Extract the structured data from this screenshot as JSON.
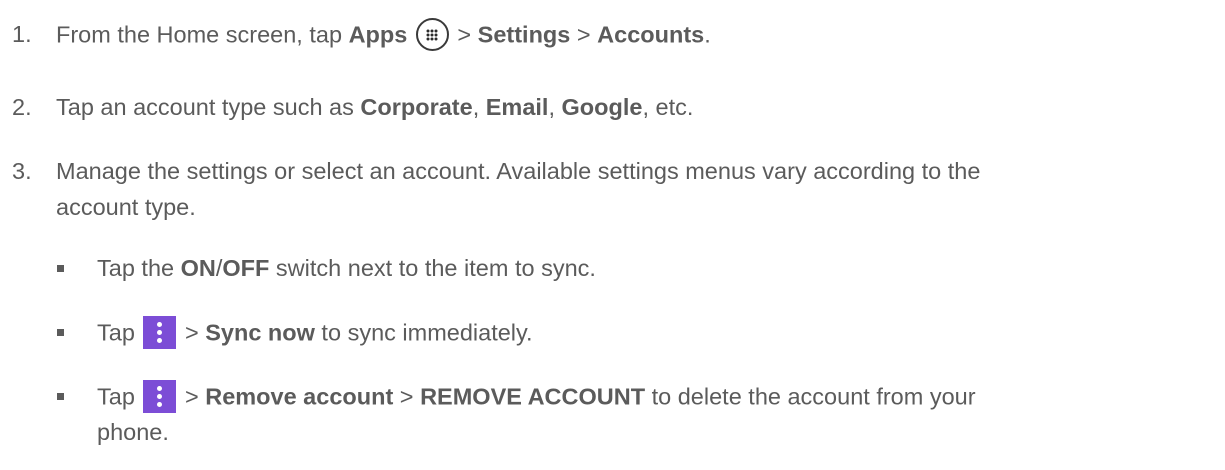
{
  "steps": [
    {
      "number": "1.",
      "pre": "From the Home screen, tap ",
      "apps": "Apps",
      "sep1": " > ",
      "settings": "Settings",
      "sep2": " > ",
      "accounts": "Accounts",
      "end": "."
    },
    {
      "number": "2.",
      "pre": "Tap an account type such as ",
      "corporate": "Corporate",
      "c1": ", ",
      "email": "Email",
      "c2": ", ",
      "google": "Google",
      "end": ", etc."
    },
    {
      "number": "3.",
      "line1": "Manage the settings or select an account. Available settings menus vary according to the",
      "line2": "account type."
    }
  ],
  "bullets": [
    {
      "pre": "Tap the ",
      "on": "ON",
      "slash": "/",
      "off": "OFF",
      "post": " switch next to the item to sync."
    },
    {
      "pre": "Tap ",
      "sep": " > ",
      "sync": "Sync now",
      "post": " to sync immediately."
    },
    {
      "pre": "Tap ",
      "sep": " > ",
      "remove": "Remove account",
      "sep2": " > ",
      "remove_caps": "REMOVE ACCOUNT",
      "post": " to delete the account from your",
      "line2": "phone."
    }
  ],
  "icons": {
    "apps": "apps-grid-icon",
    "menu": "more-vert-icon",
    "menu_color": "#7c4dd6"
  },
  "colors": {
    "text": "#5b5b5b"
  }
}
